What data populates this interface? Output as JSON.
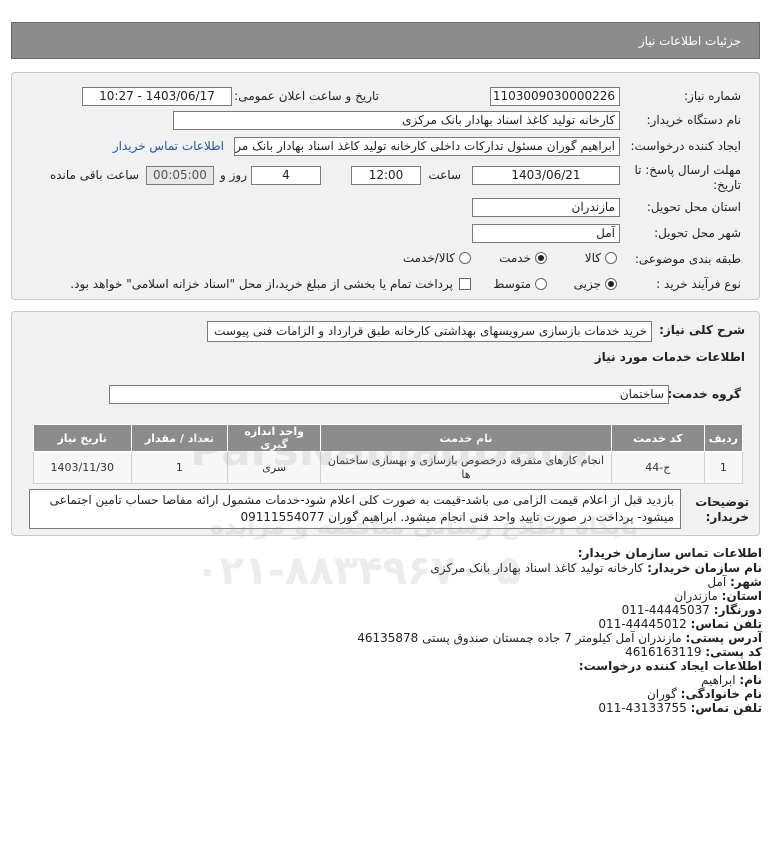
{
  "header": {
    "title": "جزئیات اطلاعات نیاز"
  },
  "need_number": {
    "label": "شماره نیاز:",
    "value": "1103009030000226"
  },
  "announce_datetime": {
    "label": "تاریخ و ساعت اعلان عمومی:",
    "value": "1403/06/17 - 10:27"
  },
  "buyer_org": {
    "label": "نام دستگاه خریدار:",
    "value": "کارخانه تولید کاغذ اسناد بهادار بانک مرکزی"
  },
  "requester": {
    "label": "ایجاد کننده درخواست:",
    "value": "ابراهیم گوران مسئول تدارکات داخلی کارخانه تولید کاغذ اسناد بهادار بانک مرکزی",
    "contact_link": "اطلاعات تماس خریدار"
  },
  "deadline": {
    "label": "مهلت ارسال پاسخ: تا تاریخ:",
    "date": "1403/06/21",
    "time_label": "ساعت",
    "time": "12:00",
    "days": "4",
    "days_label": "روز و",
    "remaining": "00:05:00",
    "remaining_label": "ساعت باقی مانده"
  },
  "delivery_province": {
    "label": "استان محل تحویل:",
    "value": "مازندران"
  },
  "delivery_city": {
    "label": "شهر محل تحویل:",
    "value": "آمل"
  },
  "category": {
    "label": "طبقه بندی موضوعی:",
    "options": [
      "کالا",
      "خدمت",
      "کالا/خدمت"
    ],
    "selected": "خدمت"
  },
  "process": {
    "label": "نوع فرآیند خرید :",
    "options": [
      "جزیی",
      "متوسط"
    ],
    "selected": "جزیی",
    "payment_note": "پرداخت تمام یا بخشی از مبلغ خرید،از محل \"اسناد خزانه اسلامی\" خواهد بود."
  },
  "summary": {
    "label": "شرح کلی نیاز:",
    "value": "خرید خدمات بازسازی سرویسهای بهداشتی کارخانه طبق قرارداد و الزامات فنی پیوست"
  },
  "services_heading": "اطلاعات خدمات مورد نیاز",
  "service_group": {
    "label": "گروه خدمت:",
    "value": "ساختمان"
  },
  "table": {
    "headers": [
      "ردیف",
      "کد خدمت",
      "نام خدمت",
      "واحد اندازه گیری",
      "تعداد / مقدار",
      "تاریخ نیاز"
    ],
    "rows": [
      [
        "1",
        "ج-44",
        "انجام کارهای متفرقه درخصوص بازسازی و بهسازی ساختمان ها",
        "سری",
        "1",
        "1403/11/30"
      ]
    ]
  },
  "buyer_notes": {
    "label": "توضیحات خریدار:",
    "value": "بازدید قبل از اعلام قیمت الزامی می باشد-قیمت به صورت کلی اعلام شود-خدمات مشمول ارائه مفاصا حساب تامین اجتماعی میشود- پرداخت در صورت تایید واحد فنی انجام میشود. ابراهیم گوران 09111554077"
  },
  "contact": {
    "heading": "اطلاعات تماس سازمان خریدار:",
    "org_label": "نام سازمان خریدار:",
    "org": "کارخانه تولید کاغذ اسناد بهادار بانک مرکزی",
    "city_label": "شهر:",
    "city": "آمل",
    "province_label": "استان:",
    "province": "مازندران",
    "fax_label": "دورنگار:",
    "fax": "011-44445037",
    "phone_label": "تلفن تماس:",
    "phone": "011-44445012",
    "address_label": "آدرس پستی:",
    "address": "مازندران آمل کیلومتر 7 جاده چمستان صندوق پستی 46135878",
    "postal_label": "کد پستی:",
    "postal": "4616163119",
    "creator_heading": "اطلاعات ایجاد کننده درخواست:",
    "name_label": "نام:",
    "name": "ابراهیم",
    "family_label": "نام خانوادگی:",
    "family": "گوران",
    "creator_phone_label": "تلفن تماس:",
    "creator_phone": "011-43133755"
  },
  "watermark": {
    "line1": "ParsNamadData",
    "line2": "پایگاه اطلاع رسانی مناقصه و مزایده",
    "phone": "۰۲۱-۸۸۳۴۹۶۷۰-۵"
  }
}
